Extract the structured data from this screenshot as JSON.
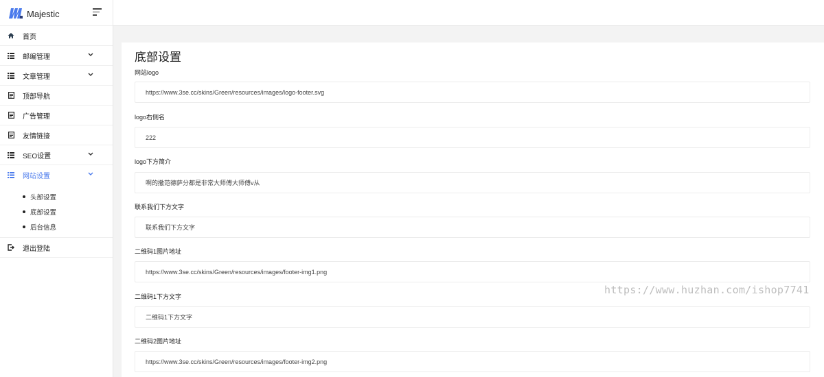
{
  "brand": {
    "name": "Majestic",
    "primary": "#4b7bec"
  },
  "sidebar": {
    "items": [
      {
        "label": "首页",
        "icon": "home-icon",
        "hasChevron": false
      },
      {
        "label": "邮编管理",
        "icon": "list-icon",
        "hasChevron": true
      },
      {
        "label": "文章管理",
        "icon": "list-icon",
        "hasChevron": true
      },
      {
        "label": "顶部导航",
        "icon": "document-icon",
        "hasChevron": false
      },
      {
        "label": "广告管理",
        "icon": "document-icon",
        "hasChevron": false
      },
      {
        "label": "友情链接",
        "icon": "document-icon",
        "hasChevron": false
      },
      {
        "label": "SEO设置",
        "icon": "list-icon",
        "hasChevron": true
      },
      {
        "label": "网站设置",
        "icon": "list-icon",
        "hasChevron": true,
        "active": true
      }
    ],
    "submenu": [
      "头部设置",
      "底部设置",
      "后台信息"
    ],
    "logout": {
      "label": "退出登陆",
      "icon": "logout-icon"
    }
  },
  "main": {
    "title": "底部设置",
    "fields": [
      {
        "label": "网站logo",
        "value": "https://www.3se.cc/skins/Green/resources/images/logo-footer.svg"
      },
      {
        "label": "logo右侧名",
        "value": "222"
      },
      {
        "label": "logo下方简介",
        "value": "啊的撒范德萨分都是非常大师傅大师傅v从"
      },
      {
        "label": "联系我们下方文字",
        "value": "联系我们下方文字"
      },
      {
        "label": "二维码1图片地址",
        "value": "https://www.3se.cc/skins/Green/resources/images/footer-img1.png"
      },
      {
        "label": "二维码1下方文字",
        "value": "二维码1下方文字"
      },
      {
        "label": "二维码2图片地址",
        "value": "https://www.3se.cc/skins/Green/resources/images/footer-img2.png"
      }
    ]
  },
  "watermark": "https://www.huzhan.com/ishop7741"
}
